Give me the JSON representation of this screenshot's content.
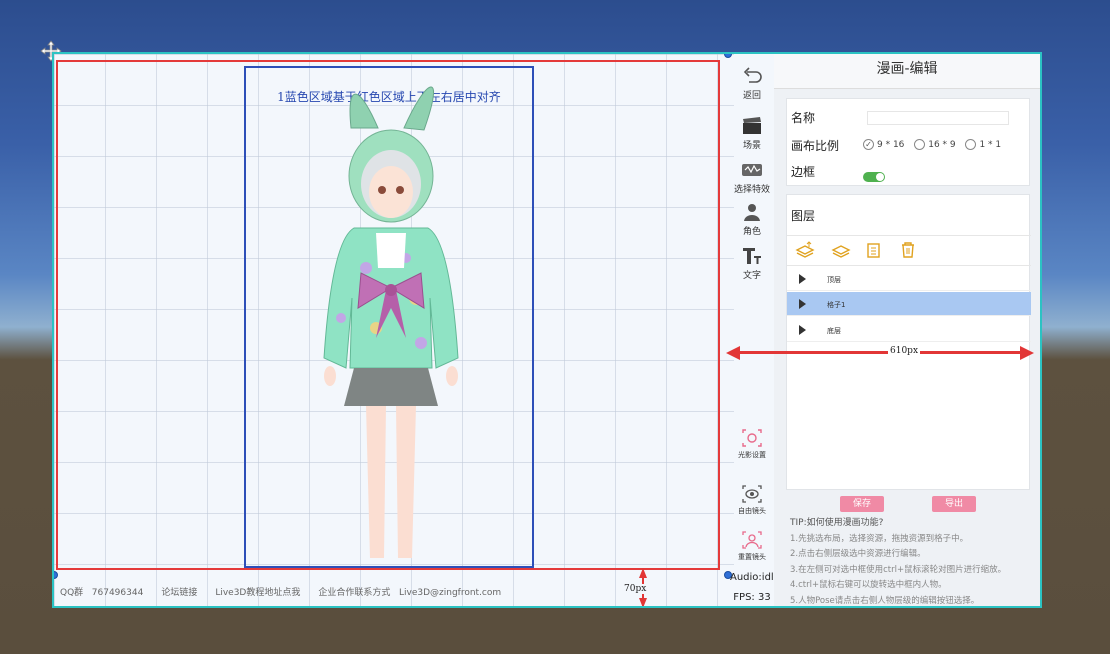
{
  "canvas": {
    "caption": "1蓝色区域基于红色区域上下左右居中对齐"
  },
  "footer": {
    "qq_label": "QQ群",
    "qq_number": "767496344",
    "forum": "论坛链接",
    "tutorial": "Live3D教程地址点我",
    "business_label": "企业合作联系方式",
    "business_email": "Live3D@zingfront.com"
  },
  "toolbar": {
    "back": "返回",
    "scene": "场景",
    "effects": "选择特效",
    "character": "角色",
    "text": "文字",
    "lighting": "光影设置",
    "free_camera": "自由镜头",
    "reset_camera": "重置镜头"
  },
  "status": {
    "audio": "Audio:idle",
    "fps": "FPS: 33"
  },
  "panel": {
    "title": "漫画-编辑",
    "name_label": "名称",
    "name_value": "",
    "ratio_label": "画布比例",
    "ratios": [
      "9 * 16",
      "16 * 9",
      "1 * 1"
    ],
    "selected_ratio": "9 * 16",
    "border_label": "边框",
    "border_on": true,
    "layers_label": "图层",
    "layers": [
      {
        "name": "顶层",
        "selected": false
      },
      {
        "name": "格子1",
        "selected": true
      },
      {
        "name": "底层",
        "selected": false
      }
    ],
    "save_button": "保存",
    "export_button": "导出",
    "tips_title": "TIP:如何使用漫画功能?",
    "tips": [
      "1.先挑选布局，选择资源，拖拽资源到格子中。",
      "2.点击右侧层级选中资源进行编辑。",
      "3.在左侧可对选中框使用ctrl+鼠标滚轮对图片进行缩放。",
      "4.ctrl+鼠标右键可以旋转选中框内人物。",
      "5.人物Pose请点击右侧人物层级的编辑按钮选择。"
    ]
  },
  "annotations": {
    "width_label": "610px",
    "height_label": "70px"
  },
  "colors": {
    "canvas_border": "#2bc3c3",
    "red_box": "#e43a3a",
    "blue_box": "#2d4fb8",
    "accent_pink": "#f08aa5",
    "layer_selected": "#a9c8f2",
    "toggle_on": "#4fb14f"
  }
}
